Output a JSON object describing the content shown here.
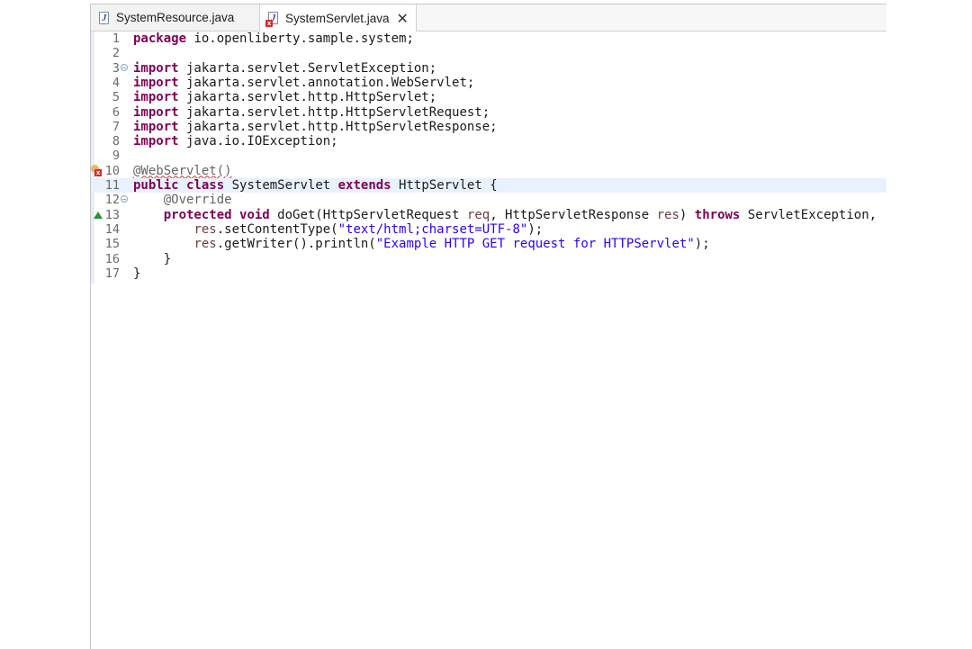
{
  "tabs": [
    {
      "label": "SystemResource.java",
      "icon": "java-file-icon",
      "active": false
    },
    {
      "label": "SystemServlet.java",
      "icon": "java-file-error-icon",
      "active": true,
      "close_glyph": "✕"
    }
  ],
  "code": {
    "lines": [
      {
        "n": "1"
      },
      {
        "n": "2"
      },
      {
        "n": "3"
      },
      {
        "n": "4"
      },
      {
        "n": "5"
      },
      {
        "n": "6"
      },
      {
        "n": "7"
      },
      {
        "n": "8"
      },
      {
        "n": "9"
      },
      {
        "n": "10"
      },
      {
        "n": "11"
      },
      {
        "n": "12"
      },
      {
        "n": "13"
      },
      {
        "n": "14"
      },
      {
        "n": "15"
      },
      {
        "n": "16"
      },
      {
        "n": "17"
      }
    ],
    "tokens": {
      "l1_kw": "package",
      "l1_rest": " io.openliberty.sample.system;",
      "l3_kw": "import",
      "l3_rest": " jakarta.servlet.ServletException;",
      "l4_kw": "import",
      "l4_rest": " jakarta.servlet.annotation.WebServlet;",
      "l5_kw": "import",
      "l5_rest": " jakarta.servlet.http.HttpServlet;",
      "l6_kw": "import",
      "l6_rest": " jakarta.servlet.http.HttpServletRequest;",
      "l7_kw": "import",
      "l7_rest": " jakarta.servlet.http.HttpServletResponse;",
      "l8_kw": "import",
      "l8_rest": " java.io.IOException;",
      "l10_ann": "@WebServlet()",
      "l11_kw1": "public",
      "l11_kw2": "class",
      "l11_name": " SystemServlet ",
      "l11_kw3": "extends",
      "l11_rest": " HttpServlet {",
      "l12_ann": "@Override",
      "l13_kw1": "protected",
      "l13_kw2": "void",
      "l13_a": " doGet(HttpServletRequest ",
      "l13_var1": "req",
      "l13_b": ", HttpServletResponse ",
      "l13_var2": "res",
      "l13_c": ") ",
      "l13_kw3": "throws",
      "l13_d": " ServletException,",
      "l14_var": "res",
      "l14_a": ".setContentType(",
      "l14_str": "\"text/html;charset=UTF-8\"",
      "l14_b": ");",
      "l15_var": "res",
      "l15_a": ".getWriter().println(",
      "l15_str": "\"Example HTTP GET request for HTTPServlet\"",
      "l15_b": ");",
      "l16": "}",
      "l17": "}"
    }
  },
  "colors": {
    "keyword": "#7f0055",
    "string": "#2a00ff",
    "annotation": "#646464",
    "variable": "#6a3e3e",
    "current_line": "#e8f2fe"
  }
}
